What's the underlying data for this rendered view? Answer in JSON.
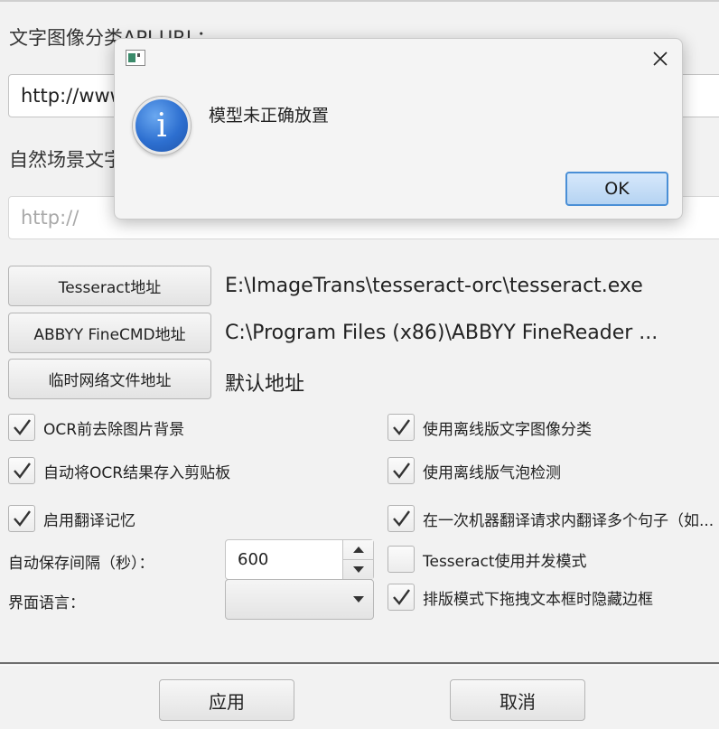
{
  "settings": {
    "text_image_api_label": "文字图像分类API URL：",
    "text_image_api_value": "http://www.",
    "scene_text_label": "自然场景文字",
    "scene_text_placeholder": "http://",
    "tesseract_button": "Tesseract地址",
    "tesseract_path": "E:\\ImageTrans\\tesseract-orc\\tesseract.exe",
    "abbyy_button": "ABBYY FineCMD地址",
    "abbyy_path": "C:\\Program Files (x86)\\ABBYY FineReader ...",
    "temp_button": "临时网络文件地址",
    "temp_path": "默认地址",
    "checks_left": [
      {
        "label": "OCR前去除图片背景",
        "checked": true
      },
      {
        "label": "自动将OCR结果存入剪贴板",
        "checked": true
      },
      {
        "label": "启用翻译记忆",
        "checked": true
      }
    ],
    "checks_right": [
      {
        "label": "使用离线版文字图像分类",
        "checked": true
      },
      {
        "label": "使用离线版气泡检测",
        "checked": true
      },
      {
        "label": "在一次机器翻译请求内翻译多个句子（如...",
        "checked": true
      },
      {
        "label": "Tesseract使用并发模式",
        "checked": false
      },
      {
        "label": "排版模式下拖拽文本框时隐藏边框",
        "checked": true
      }
    ],
    "autosave_label": "自动保存间隔（秒）：",
    "autosave_value": "600",
    "ui_language_label": "界面语言：",
    "ui_language_value": "",
    "apply_button": "应用",
    "cancel_button": "取消"
  },
  "dialog": {
    "message": "模型未正确放置",
    "ok_button": "OK",
    "icon": "information-icon"
  },
  "colors": {
    "info_blue": "#2d6fd0",
    "ok_border": "#4a8fd6"
  }
}
